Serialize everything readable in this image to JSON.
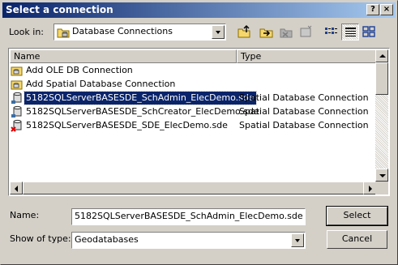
{
  "window": {
    "title": "Select a connection",
    "help_glyph": "?",
    "close_glyph": "×"
  },
  "look_in": {
    "label": "Look in:",
    "value": "Database Connections"
  },
  "toolbar": {
    "buttons": [
      "up-one-level",
      "connect-folder",
      "disconnect",
      "new-item",
      "list-view",
      "details-view",
      "thumbnail-view"
    ]
  },
  "list": {
    "columns": [
      "Name",
      "Type"
    ],
    "items": [
      {
        "name": "Add OLE DB Connection",
        "type": "",
        "icon": "add-ole-db-icon"
      },
      {
        "name": "Add Spatial Database Connection",
        "type": "",
        "icon": "add-spatial-db-icon"
      },
      {
        "name": "5182SQLServerBASESDE_SchAdmin_ElecDemo.sde",
        "type": "Spatial Database Connection",
        "icon": "sde-connection-icon",
        "selected": true
      },
      {
        "name": "5182SQLServerBASESDE_SchCreator_ElecDemo.sde",
        "type": "Spatial Database Connection",
        "icon": "sde-connection-icon"
      },
      {
        "name": "5182SQLServerBASESDE_SDE_ElecDemo.sde",
        "type": "Spatial Database Connection",
        "icon": "sde-connection-error-icon"
      }
    ]
  },
  "name_field": {
    "label": "Name:",
    "value": "5182SQLServerBASESDE_SchAdmin_ElecDemo.sde"
  },
  "type_field": {
    "label": "Show of type:",
    "value": "Geodatabases"
  },
  "buttons": {
    "select": "Select",
    "cancel": "Cancel"
  },
  "colors": {
    "title_bar": "#0a246a",
    "selection": "#0a246a",
    "dialog_face": "#d4d0c8"
  }
}
